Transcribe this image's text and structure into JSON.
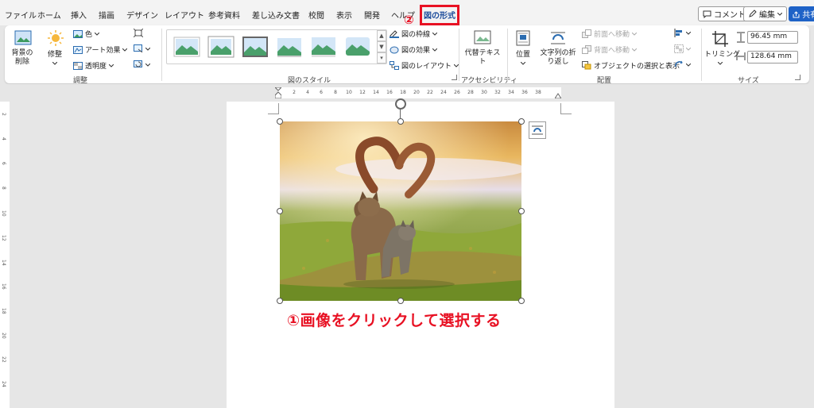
{
  "tabs": [
    "ファイル",
    "ホーム",
    "挿入",
    "描画",
    "デザイン",
    "レイアウト",
    "参考資料",
    "差し込み文書",
    "校閲",
    "表示",
    "開発",
    "ヘルプ"
  ],
  "active_tab": "図の形式",
  "annotation_marker": "②",
  "top_buttons": {
    "comment": "コメント",
    "edit": "編集",
    "share": "共有"
  },
  "ribbon": {
    "adjust": {
      "remove_bg": "背景の削除",
      "corrections": "修整",
      "color": "色",
      "art_effects": "アート効果",
      "transparency": "透明度",
      "label": "調整"
    },
    "styles": {
      "border": "図の枠線",
      "effects": "図の効果",
      "layout": "図のレイアウト",
      "label": "図のスタイル"
    },
    "accessibility": {
      "alt_text": "代替テキスト",
      "label": "アクセシビリティ"
    },
    "arrange": {
      "position": "位置",
      "wrap_text": "文字列の折り返し",
      "bring_forward": "前面へ移動",
      "send_backward": "背面へ移動",
      "selection_pane": "オブジェクトの選択と表示",
      "label": "配置"
    },
    "size": {
      "crop": "トリミング",
      "height": "96.45 mm",
      "width": "128.64 mm",
      "label": "サイズ"
    }
  },
  "ruler_marks": [
    "2",
    "4",
    "6",
    "8",
    "10",
    "12",
    "14",
    "16",
    "18",
    "20",
    "22",
    "24",
    "26",
    "28",
    "30",
    "32",
    "34",
    "36",
    "38"
  ],
  "vruler_marks": [
    "2",
    "4",
    "6",
    "8",
    "10",
    "12",
    "14",
    "16",
    "18",
    "20",
    "22",
    "24"
  ],
  "caption": "①画像をクリックして選択する",
  "colors": {
    "accent_red": "#e81123",
    "active_tab": "#1f4e9c",
    "share_blue": "#1e62c7"
  }
}
